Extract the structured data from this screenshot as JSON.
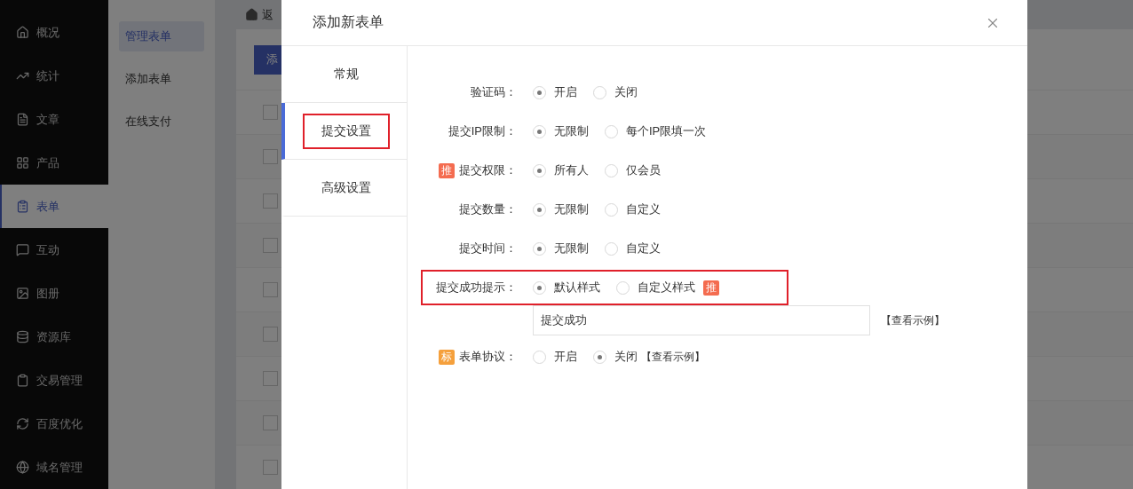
{
  "sidebar": {
    "items": [
      {
        "label": "概况",
        "selected": false
      },
      {
        "label": "统计",
        "selected": false
      },
      {
        "label": "文章",
        "selected": false
      },
      {
        "label": "产品",
        "selected": false
      },
      {
        "label": "表单",
        "selected": true
      },
      {
        "label": "互动",
        "selected": false
      },
      {
        "label": "图册",
        "selected": false
      },
      {
        "label": "资源库",
        "selected": false
      },
      {
        "label": "交易管理",
        "selected": false
      },
      {
        "label": "百度优化",
        "selected": false
      },
      {
        "label": "域名管理",
        "selected": false
      }
    ]
  },
  "subnav": {
    "items": [
      {
        "label": "管理表单",
        "selected": true
      },
      {
        "label": "添加表单",
        "selected": false
      },
      {
        "label": "在线支付",
        "selected": false
      }
    ]
  },
  "breadcrumb": {
    "back": "返"
  },
  "toolbar": {
    "add_button": "添"
  },
  "table": {
    "rows": [
      {
        "checked": false
      },
      {
        "checked": false
      },
      {
        "checked": false
      },
      {
        "checked": false
      },
      {
        "checked": false
      },
      {
        "checked": false
      },
      {
        "checked": false
      },
      {
        "checked": false
      },
      {
        "checked": false
      }
    ]
  },
  "modal": {
    "title": "添加新表单",
    "tabs": [
      {
        "label": "常规",
        "selected": false,
        "highlighted": false
      },
      {
        "label": "提交设置",
        "selected": true,
        "highlighted": true
      },
      {
        "label": "高级设置",
        "selected": false,
        "highlighted": false
      }
    ],
    "rows": [
      {
        "kind": "radio",
        "label": "验证码：",
        "highlighted": false,
        "options": [
          {
            "label": "开启",
            "selected": true
          },
          {
            "label": "关闭",
            "selected": false
          }
        ]
      },
      {
        "kind": "radio",
        "label": "提交IP限制：",
        "highlighted": false,
        "options": [
          {
            "label": "无限制",
            "selected": true
          },
          {
            "label": "每个IP限填一次",
            "selected": false
          }
        ]
      },
      {
        "kind": "radio",
        "label": "提交权限：",
        "badge": {
          "text": "推",
          "color": "#f46c50"
        },
        "highlighted": false,
        "options": [
          {
            "label": "所有人",
            "selected": true
          },
          {
            "label": "仅会员",
            "selected": false
          }
        ]
      },
      {
        "kind": "radio",
        "label": "提交数量：",
        "highlighted": false,
        "options": [
          {
            "label": "无限制",
            "selected": true
          },
          {
            "label": "自定义",
            "selected": false
          }
        ]
      },
      {
        "kind": "radio",
        "label": "提交时间：",
        "highlighted": false,
        "options": [
          {
            "label": "无限制",
            "selected": true
          },
          {
            "label": "自定义",
            "selected": false
          }
        ]
      },
      {
        "kind": "radio",
        "label": "提交成功提示：",
        "highlighted": true,
        "options": [
          {
            "label": "默认样式",
            "selected": true
          },
          {
            "label": "自定义样式",
            "selected": false,
            "badge": {
              "text": "推",
              "color": "#f46c50"
            }
          }
        ]
      },
      {
        "kind": "field",
        "value": "提交成功",
        "link": "【查看示例】"
      },
      {
        "kind": "radio",
        "label": "表单协议：",
        "badge": {
          "text": "标",
          "color": "#f5a03c"
        },
        "highlighted": false,
        "options": [
          {
            "label": "开启",
            "selected": false
          },
          {
            "label": "关闭",
            "selected": true
          }
        ],
        "link": "【查看示例】"
      }
    ]
  }
}
